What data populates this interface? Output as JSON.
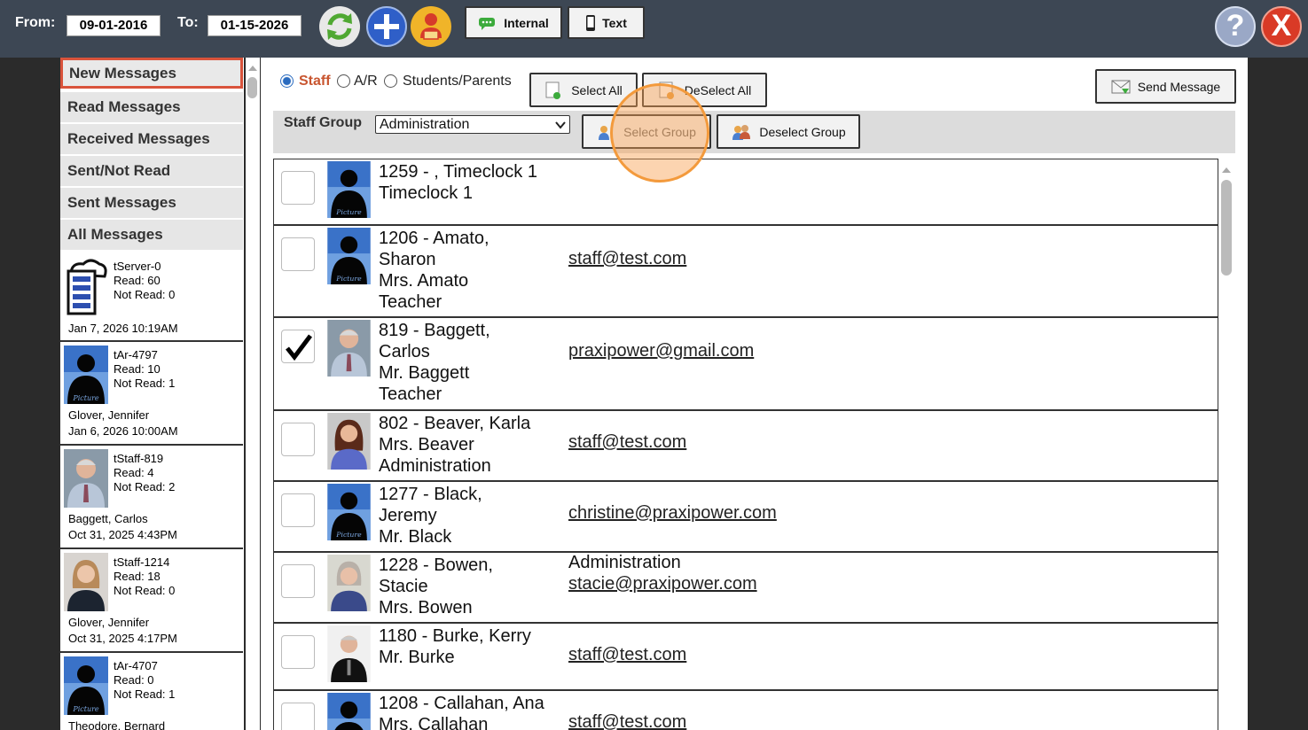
{
  "topbar": {
    "from_label": "From:",
    "from_date": "09-01-2016",
    "to_label": "To:",
    "to_date": "01-15-2026",
    "internal_label": "Internal",
    "text_label": "Text",
    "help_symbol": "?",
    "close_symbol": "X",
    "icons": [
      "refresh-icon",
      "add-icon",
      "reader-icon",
      "chat-icon",
      "phone-icon",
      "help-icon",
      "close-icon"
    ],
    "colors": {
      "bar": "#3d4754",
      "add": "#2f5fc8",
      "help": "#9aa8c6",
      "close": "#d93a26"
    }
  },
  "sidebar": {
    "nav": [
      {
        "label": "New Messages",
        "active": true
      },
      {
        "label": "Read Messages"
      },
      {
        "label": "Received Messages"
      },
      {
        "label": "Sent/Not Read"
      },
      {
        "label": "Sent Messages"
      },
      {
        "label": "All Messages"
      }
    ],
    "cards": [
      {
        "id": "tServer-0",
        "read": "Read: 60",
        "notread": "Not Read: 0",
        "name": "",
        "date": "Jan 7, 2026 10:19AM",
        "avatar": "server"
      },
      {
        "id": "tAr-4797",
        "read": "Read: 10",
        "notread": "Not Read: 1",
        "name": "Glover, Jennifer",
        "date": "Jan 6, 2026 10:00AM",
        "avatar": "silhouette"
      },
      {
        "id": "tStaff-819",
        "read": "Read: 4",
        "notread": "Not Read: 2",
        "name": "Baggett, Carlos",
        "date": "Oct 31, 2025 4:43PM",
        "avatar": "man-gray"
      },
      {
        "id": "tStaff-1214",
        "read": "Read: 18",
        "notread": "Not Read: 0",
        "name": "Glover, Jennifer",
        "date": "Oct 31, 2025 4:17PM",
        "avatar": "woman-blonde"
      },
      {
        "id": "tAr-4707",
        "read": "Read: 0",
        "notread": "Not Read: 1",
        "name": "Theodore, Bernard",
        "date": "",
        "avatar": "silhouette"
      }
    ],
    "picture_caption": "Picture"
  },
  "main": {
    "recipient_types": [
      "Staff",
      "A/R",
      "Students/Parents"
    ],
    "selected_type": "Staff",
    "select_all": "Select All",
    "deselect_all": "DeSelect All",
    "send_message": "Send Message",
    "staff_group_label": "Staff Group",
    "staff_group_value": "Administration",
    "select_group": "Select Group",
    "deselect_group": "Deselect Group"
  },
  "staff": [
    {
      "lines": [
        "1259 - , Timeclock 1",
        "Timeclock 1"
      ],
      "email": "",
      "role": "",
      "checked": false,
      "avatar": "silhouette"
    },
    {
      "lines": [
        "1206 - Amato,",
        "Sharon",
        "Mrs. Amato",
        "Teacher"
      ],
      "email": "staff@test.com",
      "role": "",
      "checked": false,
      "avatar": "silhouette"
    },
    {
      "lines": [
        "819 - Baggett,",
        "Carlos",
        "Mr. Baggett",
        "Teacher"
      ],
      "email": "praxipower@gmail.com",
      "role": "",
      "checked": true,
      "avatar": "man-gray"
    },
    {
      "lines": [
        "802 - Beaver, Karla",
        "Mrs. Beaver",
        "Administration"
      ],
      "email": "staff@test.com",
      "role": "",
      "checked": false,
      "avatar": "woman-brown"
    },
    {
      "lines": [
        "1277 - Black,",
        "Jeremy",
        "Mr. Black"
      ],
      "email": "christine@praxipower.com",
      "role": "",
      "checked": false,
      "avatar": "silhouette"
    },
    {
      "lines": [
        "1228 - Bowen,",
        "Stacie",
        "Mrs. Bowen"
      ],
      "email": "stacie@praxipower.com",
      "role": "Administration",
      "checked": false,
      "avatar": "woman-gray"
    },
    {
      "lines": [
        "1180 - Burke, Kerry",
        "Mr. Burke"
      ],
      "email": "staff@test.com",
      "role": "",
      "checked": false,
      "avatar": "man-suit"
    },
    {
      "lines": [
        "1208 - Callahan, Ana",
        "Mrs. Callahan"
      ],
      "email": "staff@test.com",
      "role": "",
      "checked": false,
      "avatar": "silhouette"
    }
  ]
}
